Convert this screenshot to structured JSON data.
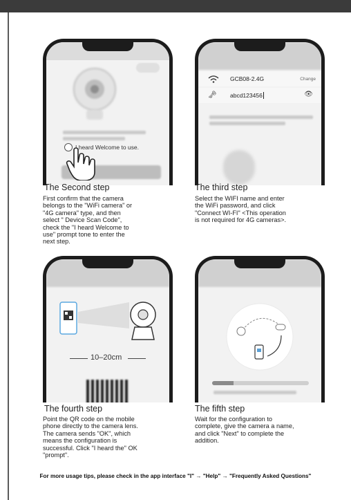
{
  "steps": [
    {
      "title": "The Second step",
      "lines": [
        "First confirm that the camera",
        "belongs to the \"WiFi camera\" or",
        "\"4G camera\" type, and then",
        "select \" Device Scan Code\",",
        "check the   \"I heard Welcome to",
        "use\" prompt tone  to enter the",
        "next step."
      ],
      "screen": {
        "prompt": "I heard Welcome to use."
      }
    },
    {
      "title": "The third step",
      "lines": [
        "Select the WIFI name and enter",
        "the WiFi password, and click",
        "\"Connect WI-FI\" <This operation",
        "is not required for 4G cameras>."
      ],
      "screen": {
        "wifi_name": "GCB08-2.4G",
        "change_label": "Change",
        "password": "abcd123456"
      }
    },
    {
      "title": "The fourth step",
      "lines": [
        "Point the QR code on the mobile",
        "phone directly to the camera lens.",
        "The camera sends \"OK\", which",
        "means the configuration is",
        "successful. Click \"I heard  the\" OK",
        "\"prompt\"."
      ],
      "screen": {
        "distance": "10–20cm"
      }
    },
    {
      "title": "The fifth step",
      "lines": [
        "Wait for the configuration to",
        "complete, give the camera a name,",
        "and click \"Next\" to complete the",
        "addition."
      ],
      "screen": {
        "progress": 0.22
      }
    }
  ],
  "footer": "For more usage tips, please check in the app interface \"I\" → \"Help\" → \"Frequently Asked Questions\""
}
